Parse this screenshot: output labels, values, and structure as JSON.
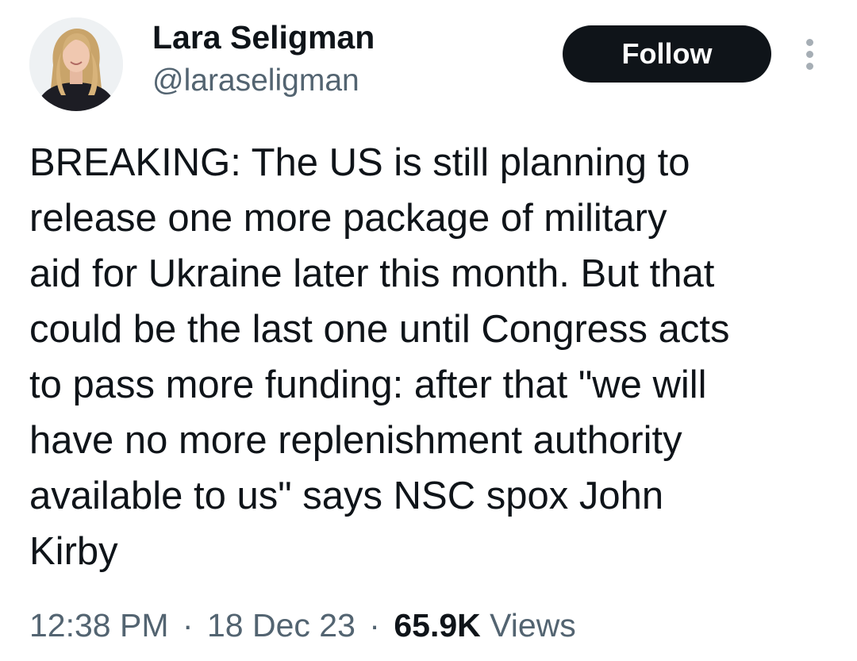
{
  "author": {
    "name": "Lara Seligman",
    "handle": "@laraseligman"
  },
  "follow_button": {
    "label": "Follow"
  },
  "tweet": {
    "text": "BREAKING: The US is still planning to\nrelease one more package of military\naid for Ukraine later this month. But that\ncould be the last one until Congress acts\nto pass more funding: after that \"we will\nhave no more replenishment authority\navailable to us\" says NSC spox John\nKirby"
  },
  "meta": {
    "time": "12:38 PM",
    "separator": "·",
    "date": "18 Dec 23",
    "views_count": "65.9K",
    "views_label": "Views"
  },
  "icons": {
    "more": "more-vertical-icon",
    "avatar": "profile-photo"
  },
  "colors": {
    "text_primary": "#0f1419",
    "text_secondary": "#536471",
    "button_bg": "#0f1419",
    "button_text": "#ffffff",
    "more_icon": "#a6aeb5"
  }
}
